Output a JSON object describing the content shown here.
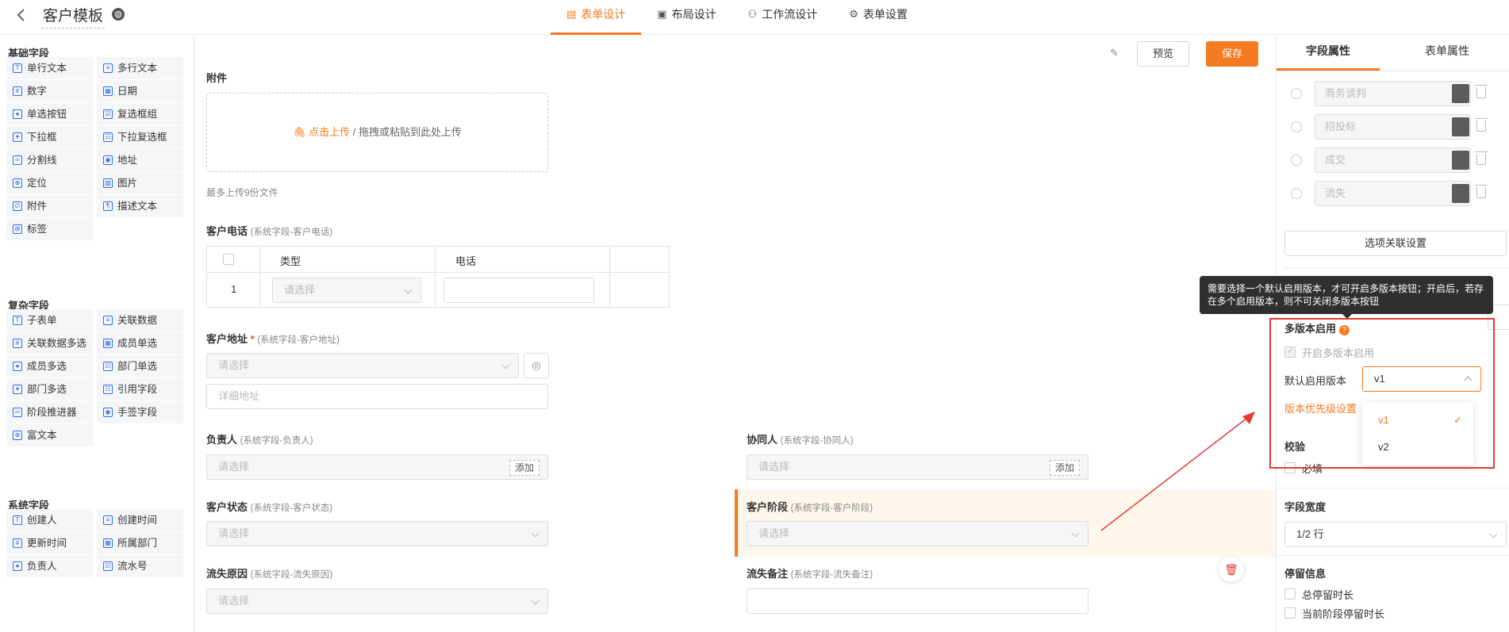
{
  "header": {
    "title": "客户模板",
    "tabs": [
      {
        "label": "表单设计",
        "active": true
      },
      {
        "label": "布局设计",
        "active": false
      },
      {
        "label": "工作流设计",
        "active": false
      },
      {
        "label": "表单设置",
        "active": false
      }
    ]
  },
  "left": {
    "basic_title": "基础字段",
    "basic": [
      "单行文本",
      "多行文本",
      "数字",
      "日期",
      "单选按钮",
      "复选框组",
      "下拉框",
      "下拉复选框",
      "分割线",
      "地址",
      "定位",
      "图片",
      "附件",
      "描述文本",
      "标签"
    ],
    "complex_title": "复杂字段",
    "complex": [
      "子表单",
      "关联数据",
      "关联数据多选",
      "成员单选",
      "成员多选",
      "部门单选",
      "部门多选",
      "引用字段",
      "阶段推进器",
      "手签字段",
      "富文本"
    ],
    "system_title": "系统字段",
    "system": [
      "创建人",
      "创建时间",
      "更新时间",
      "所属部门",
      "负责人",
      "流水号"
    ]
  },
  "toolbar": {
    "preview": "预览",
    "save": "保存"
  },
  "form": {
    "attach_label": "附件",
    "upload_link": "点击上传",
    "upload_hint": " / 拖拽或粘贴到此处上传",
    "upload_limit": "最多上传9份文件",
    "phone_label": "客户电话",
    "phone_sub": "(系统字段-客户电话)",
    "phone_cols": [
      "类型",
      "电话"
    ],
    "phone_row_no": "1",
    "select_ph": "请选择",
    "address_label": "客户地址",
    "address_req": "*",
    "address_sub": "(系统字段-客户地址)",
    "address_detail_ph": "详细地址",
    "owner_label": "负责人",
    "owner_sub": "(系统字段-负责人)",
    "collab_label": "协同人",
    "collab_sub": "(系统字段-协同人)",
    "add": "添加",
    "status_label": "客户状态",
    "status_sub": "(系统字段-客户状态)",
    "stage_label": "客户阶段",
    "stage_sub": "(系统字段-客户阶段)",
    "lost_label": "流失原因",
    "lost_sub": "(系统字段-流失原因)",
    "lostnote_label": "流失备注",
    "lostnote_sub": "(系统字段-流失备注)"
  },
  "right": {
    "tabs": [
      "字段属性",
      "表单属性"
    ],
    "options": [
      "商务谈判",
      "招投标",
      "成交",
      "流失"
    ],
    "option_link_btn": "选项关联设置",
    "tooltip": "需要选择一个默认启用版本，才可开启多版本按钮；开启后，若存在多个启用版本，则不可关闭多版本按钮",
    "multiver_title": "多版本启用",
    "multiver_check": "开启多版本启用",
    "default_ver_label": "默认启用版本",
    "default_ver_value": "v1",
    "priority_link": "版本优先级设置",
    "versions": [
      "v1",
      "v2"
    ],
    "validate_title": "校验",
    "required_label": "必填",
    "width_title": "字段宽度",
    "width_value": "1/2 行",
    "stay_title": "停留信息",
    "stay_total": "总停留时长",
    "stay_current": "当前阶段停留时长"
  },
  "colors": {
    "accent": "#f47b20",
    "annotation": "#e53935",
    "field_icon": "#2b6ef2"
  }
}
